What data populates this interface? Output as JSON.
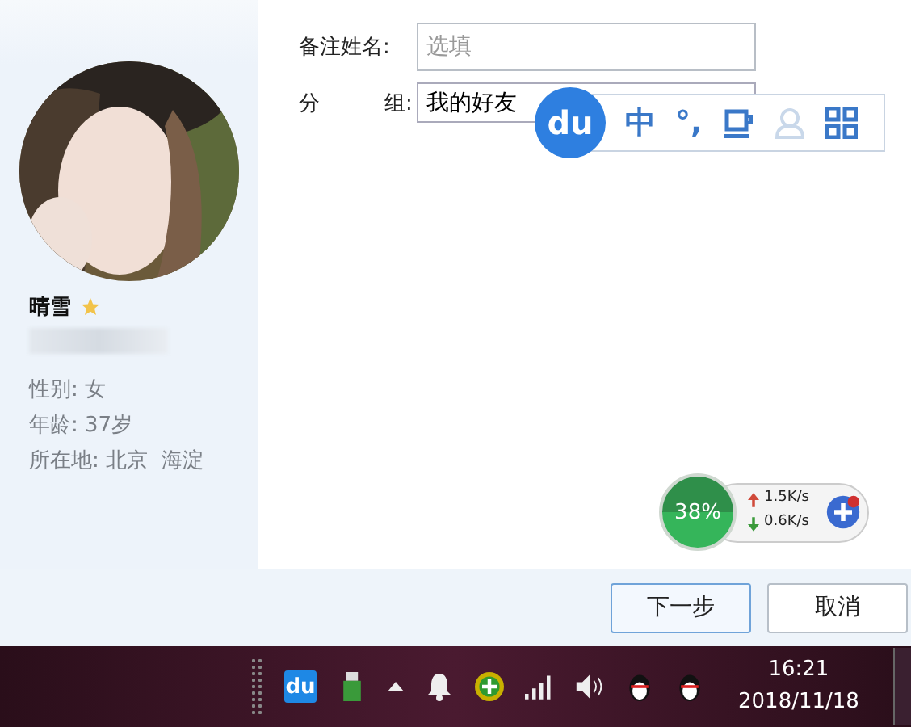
{
  "profile": {
    "name": "晴雪",
    "starred": true,
    "details": [
      "性别: 女",
      "年龄: 37岁",
      "所在地: 北京  海淀"
    ]
  },
  "form": {
    "remark_label": "备注姓名:",
    "remark_placeholder": "选填",
    "group_label_1": "分",
    "group_label_2": "组:",
    "group_value": "我的好友"
  },
  "ime_bar": {
    "logo": "du",
    "mode": "中",
    "punct": "°,"
  },
  "net_widget": {
    "percent": "38%",
    "upload": "1.5K/s",
    "download": "0.6K/s"
  },
  "buttons": [
    {
      "label": "下一步",
      "primary": true
    },
    {
      "label": "取消",
      "primary": false
    }
  ],
  "taskbar": {
    "ime_tray": "du",
    "time": "16:21",
    "date": "2018/11/18"
  }
}
